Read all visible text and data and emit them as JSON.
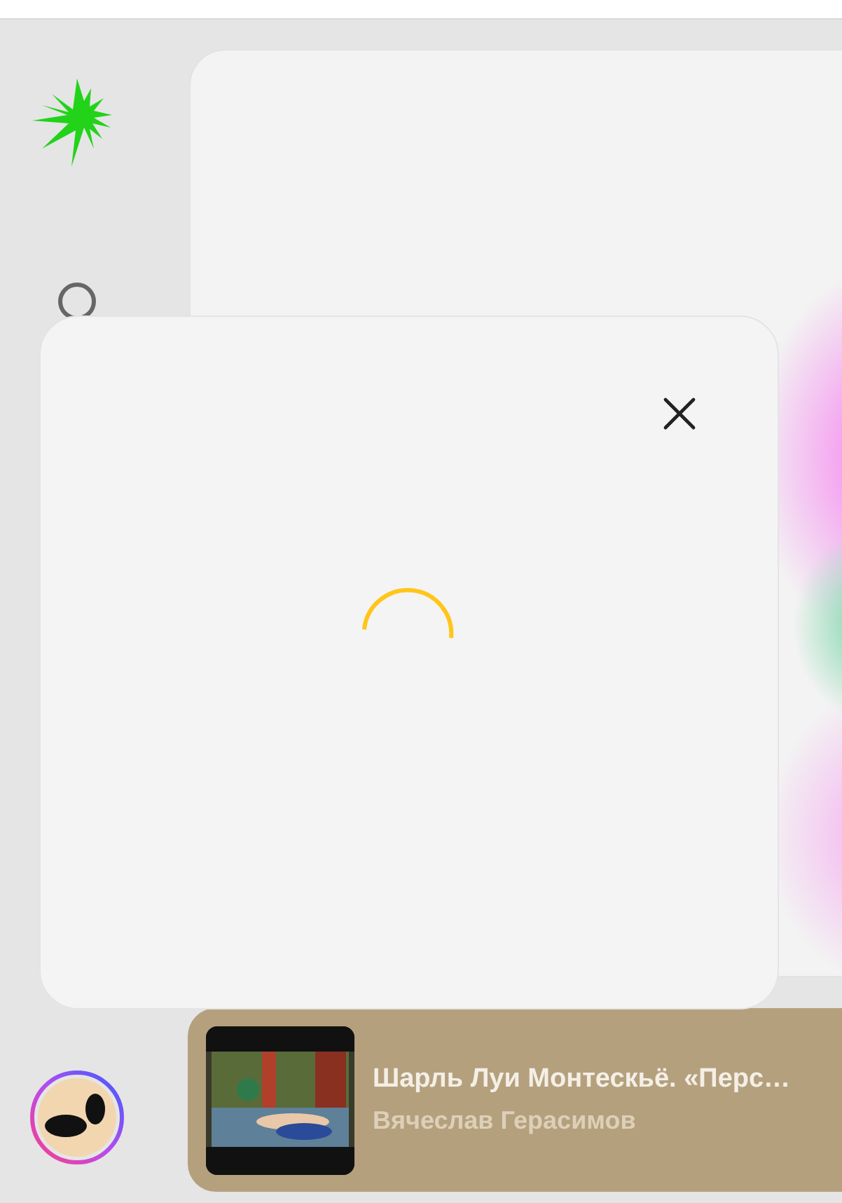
{
  "modal": {
    "loading": true
  },
  "player": {
    "title": "Шарль Луи Монтескьё. «Перс…",
    "artist": "Вячеслав Герасимов"
  }
}
